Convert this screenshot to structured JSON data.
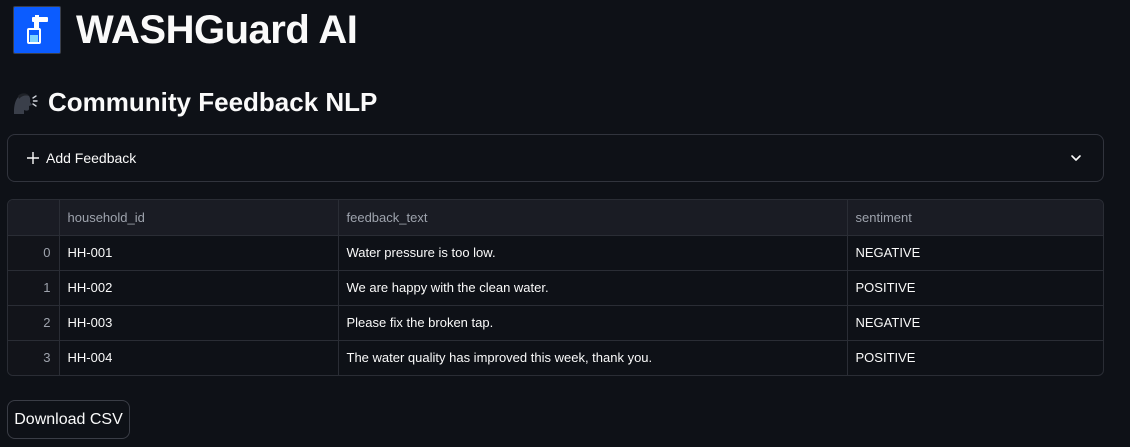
{
  "app": {
    "title": "WASHGuard AI",
    "logo_icon": "water-tap-icon",
    "logo_bg": "#0b5cff"
  },
  "section": {
    "title": "Community Feedback NLP",
    "icon": "speaking-head-icon"
  },
  "expander": {
    "label": "Add Feedback",
    "icon": "plus-icon",
    "toggle_icon": "chevron-down-icon",
    "expanded": false
  },
  "table": {
    "columns": [
      "",
      "household_id",
      "feedback_text",
      "sentiment"
    ],
    "rows": [
      {
        "index": "0",
        "household_id": "HH-001",
        "feedback_text": "Water pressure is too low.",
        "sentiment": "NEGATIVE"
      },
      {
        "index": "1",
        "household_id": "HH-002",
        "feedback_text": "We are happy with the clean water.",
        "sentiment": "POSITIVE"
      },
      {
        "index": "2",
        "household_id": "HH-003",
        "feedback_text": "Please fix the broken tap.",
        "sentiment": "NEGATIVE"
      },
      {
        "index": "3",
        "household_id": "HH-004",
        "feedback_text": "The water quality has improved this week, thank you.",
        "sentiment": "POSITIVE"
      }
    ]
  },
  "actions": {
    "download_label": "Download CSV"
  }
}
